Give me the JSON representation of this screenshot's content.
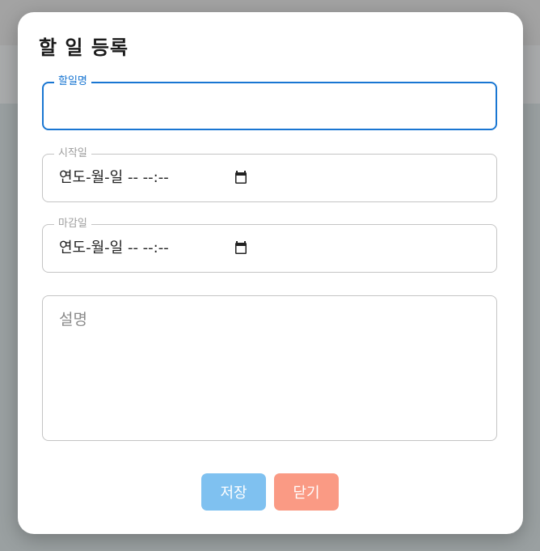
{
  "dialog": {
    "title": "할 일 등록",
    "fields": {
      "name": {
        "label": "할일명",
        "value": ""
      },
      "start": {
        "label": "시작일",
        "display": "연도-월-일 -- --:--"
      },
      "end": {
        "label": "마감일",
        "display": "연도-월-일 -- --:--"
      },
      "description": {
        "placeholder": "설명"
      }
    },
    "buttons": {
      "save": "저장",
      "close": "닫기"
    }
  },
  "colors": {
    "focus": "#1976d2",
    "save_button": "#7fc1f0",
    "close_button": "#fa9a84",
    "overlay": "#9d9fa0"
  },
  "icons": {
    "date_picker": "calendar-icon"
  }
}
